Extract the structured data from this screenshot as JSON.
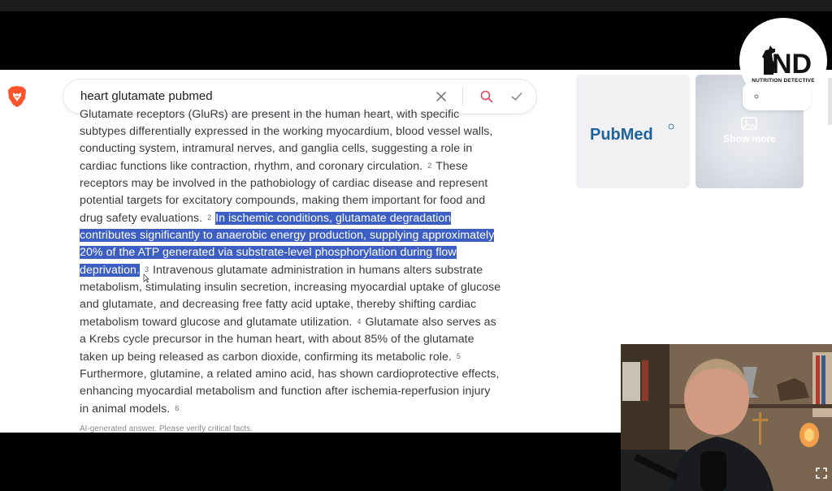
{
  "search": {
    "query": "heart glutamate pubmed"
  },
  "answer": {
    "lines": [
      {
        "segments": [
          {
            "text": "Glutamate receptors (GluRs) are present in the human heart, with specific"
          }
        ]
      },
      {
        "segments": [
          {
            "text": "subtypes differentially expressed in the working myocardium, blood vessel walls,"
          }
        ]
      },
      {
        "segments": [
          {
            "text": "conducting system, intramural nerves, and ganglia cells, suggesting a role in"
          }
        ]
      },
      {
        "segments": [
          {
            "text": "cardiac functions like contraction, rhythm, and coronary circulation."
          },
          {
            "cite": "2"
          },
          {
            "text": "These"
          }
        ]
      },
      {
        "segments": [
          {
            "text": "receptors may be involved in the pathobiology of cardiac disease and represent"
          }
        ]
      },
      {
        "segments": [
          {
            "text": "potential targets for excitatory compounds, making them important for food and"
          }
        ]
      },
      {
        "segments": [
          {
            "text": "drug safety evaluations."
          },
          {
            "cite": "2"
          },
          {
            "text": "In ischemic conditions, glutamate degradation",
            "hl": true
          }
        ]
      },
      {
        "segments": [
          {
            "text": "contributes significantly to anaerobic energy production, supplying approximately",
            "hl": true
          }
        ]
      },
      {
        "segments": [
          {
            "text": "20% of the ATP generated via substrate-level phosphorylation during flow",
            "hl": true
          }
        ]
      },
      {
        "segments": [
          {
            "text": "deprivation.",
            "hl": true
          },
          {
            "cite": "3"
          },
          {
            "text": "Intravenous glutamate administration in humans alters substrate"
          }
        ]
      },
      {
        "segments": [
          {
            "text": "metabolism, stimulating insulin secretion, increasing myocardial uptake of glucose"
          }
        ]
      },
      {
        "segments": [
          {
            "text": "and glutamate, and decreasing free fatty acid uptake, thereby shifting cardiac"
          }
        ]
      },
      {
        "segments": [
          {
            "text": "metabolism toward glucose and glutamate utilization."
          },
          {
            "cite": "4"
          },
          {
            "text": "Glutamate also serves as"
          }
        ]
      },
      {
        "segments": [
          {
            "text": "a Krebs cycle precursor in the human heart, with about 85% of the glutamate"
          }
        ]
      },
      {
        "segments": [
          {
            "text": "taken up being released as carbon dioxide, confirming its metabolic role."
          },
          {
            "cite": "5"
          }
        ]
      },
      {
        "segments": [
          {
            "text": "Furthermore, glutamine, a related amino acid, has shown cardioprotective effects,"
          }
        ]
      },
      {
        "segments": [
          {
            "text": "enhancing myocardial metabolism and function after ischemia-reperfusion injury"
          }
        ]
      },
      {
        "segments": [
          {
            "text": "in animal models."
          },
          {
            "cite": "6"
          }
        ]
      }
    ],
    "disclaimer": "AI-generated answer. Please verify critical facts."
  },
  "images": {
    "pubmed_logo_text": "PubMed",
    "show_more_label": "Show more"
  },
  "overlay": {
    "brand_label": "NUTRITION DETECTIVE",
    "brand_logo_text": "ND"
  },
  "icons": {
    "brave": "brave-lion-icon",
    "clear": "close-icon",
    "search": "search-icon",
    "submit": "checkmark-icon",
    "image": "image-icon",
    "expand": "expand-icon"
  },
  "colors": {
    "highlight": "#3d5fc4",
    "pubmed_blue": "#20639b",
    "brave_orange": "#fb542b",
    "search_icon_red": "#e0435a"
  }
}
